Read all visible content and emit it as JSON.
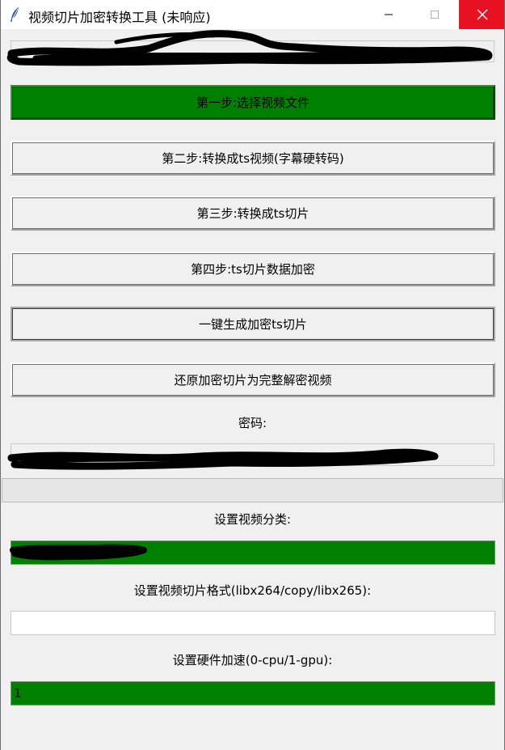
{
  "window": {
    "title": "视频切片加密转换工具 (未响应)"
  },
  "buttons": {
    "step1": "第一步:选择视频文件",
    "step2": "第二步:转换成ts视频(字幕硬转码)",
    "step3": "第三步:转换成ts切片",
    "step4": "第四步:ts切片数据加密",
    "one_click": "一键生成加密ts切片",
    "restore": "还原加密切片为完整解密视频"
  },
  "password": {
    "label": "密码:"
  },
  "progress": {
    "value": 0
  },
  "category": {
    "label": "设置视频分类:"
  },
  "format": {
    "label": "设置视频切片格式(libx264/copy/libx265):",
    "value": ""
  },
  "hwaccel": {
    "label": "设置硬件加速(0-cpu/1-gpu):",
    "value": "1"
  },
  "colors": {
    "accent_green": "#008000",
    "close_red": "#e81123"
  }
}
